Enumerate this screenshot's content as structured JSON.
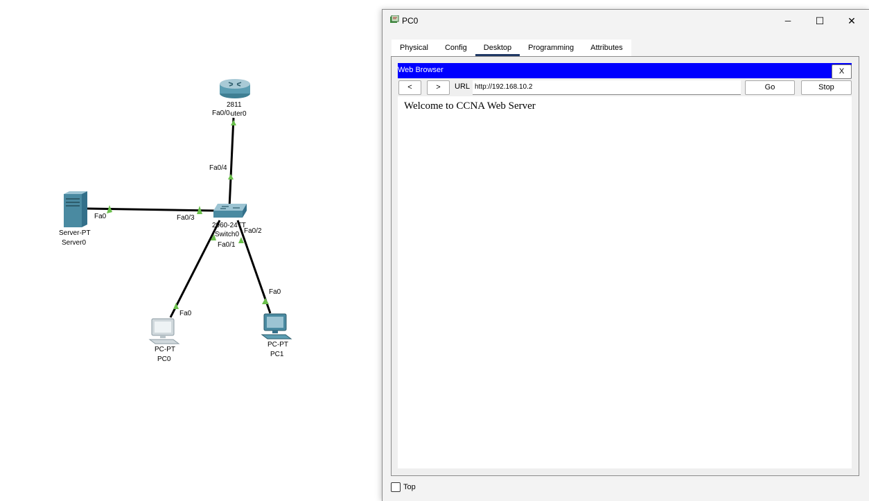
{
  "topology": {
    "router": {
      "model": "2811",
      "name": "Router0",
      "port": "Fa0/0"
    },
    "switch": {
      "model": "2960-24TT",
      "name": "Switch0",
      "ports": {
        "uplink": "Fa0/4",
        "server": "Fa0/3",
        "pc0": "Fa0/1",
        "pc1": "Fa0/2"
      }
    },
    "server": {
      "model": "Server-PT",
      "name": "Server0",
      "port": "Fa0"
    },
    "pc0": {
      "model": "PC-PT",
      "name": "PC0",
      "port": "Fa0"
    },
    "pc1": {
      "model": "PC-PT",
      "name": "PC1",
      "port": "Fa0"
    }
  },
  "window": {
    "title": "PC0",
    "controls": {
      "minimize": "─",
      "maximize": "☐",
      "close": "✕"
    },
    "tabs": [
      "Physical",
      "Config",
      "Desktop",
      "Programming",
      "Attributes"
    ],
    "active_tab": "Desktop",
    "browser": {
      "title": "Web Browser",
      "close_label": "X",
      "back_label": "<",
      "forward_label": ">",
      "url_label": "URL",
      "url_value": "http://192.168.10.2",
      "go_label": "Go",
      "stop_label": "Stop",
      "page_text": "Welcome to CCNA Web Server"
    },
    "top_checkbox_label": "Top"
  },
  "colors": {
    "link": "#000000",
    "port_up": "#6abf4b",
    "browser_bar": "#0000ff",
    "tab_indicator": "#1f3864"
  }
}
